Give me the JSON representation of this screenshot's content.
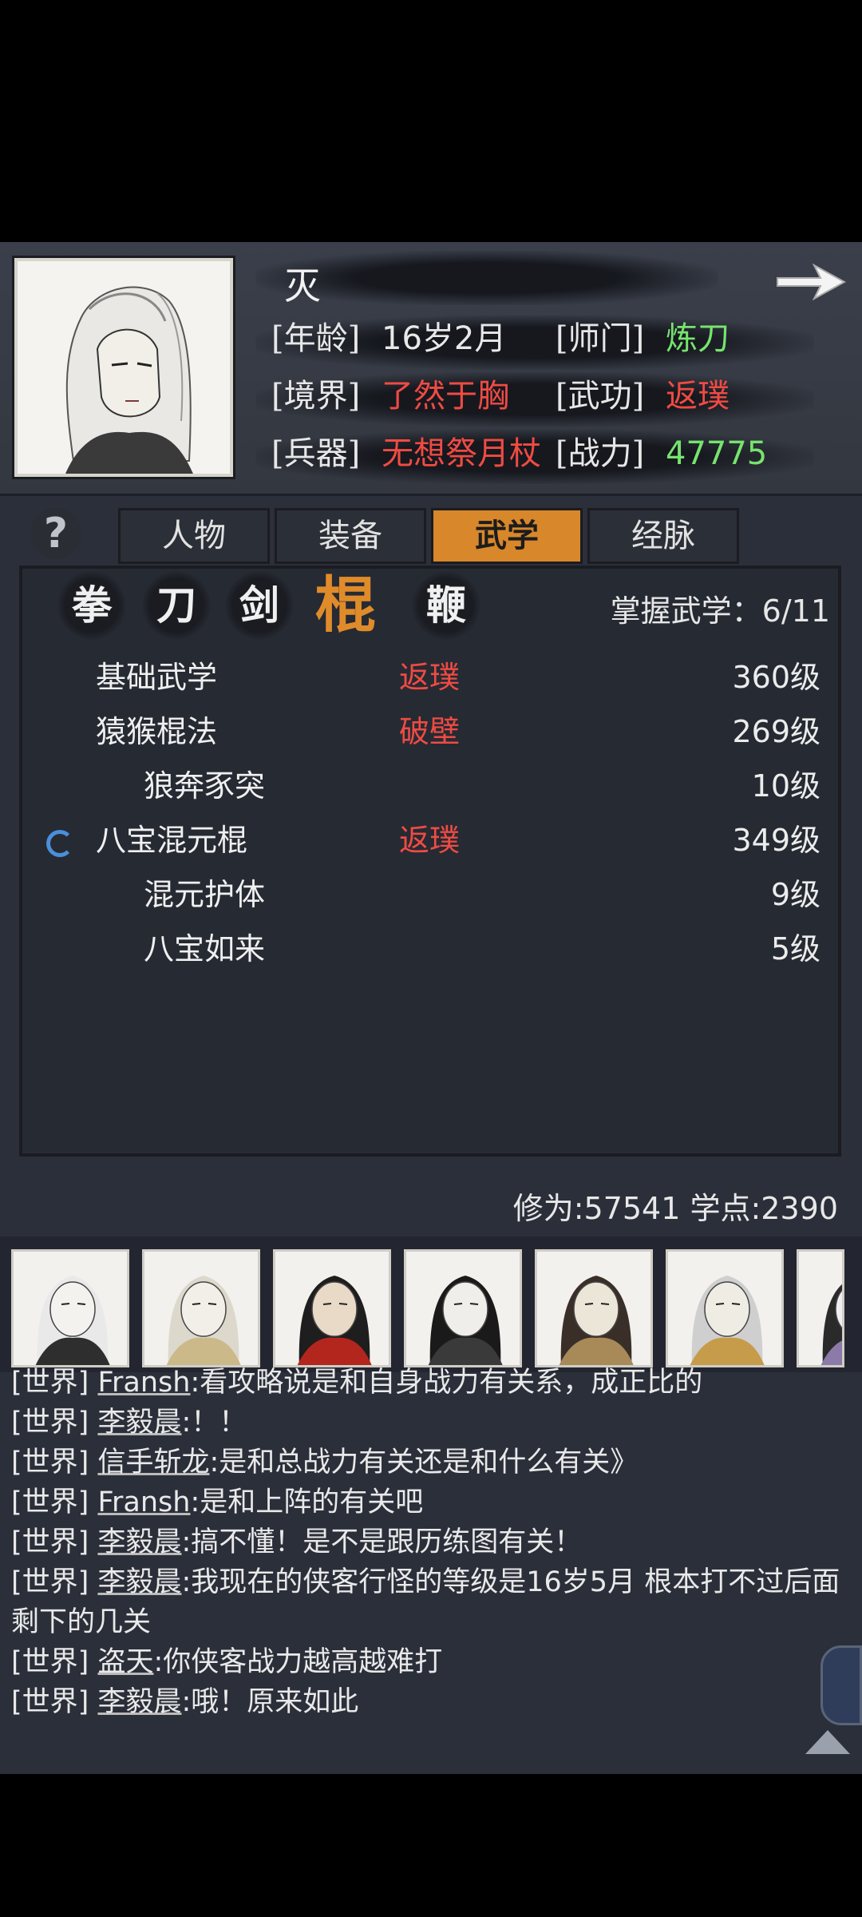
{
  "profile": {
    "name": "灭",
    "stats": [
      {
        "key": "[年龄]",
        "value": "16岁2月",
        "color": "white"
      },
      {
        "key": "[师门]",
        "value": "炼刀",
        "color": "green"
      },
      {
        "key": "[境界]",
        "value": "了然于胸",
        "color": "red"
      },
      {
        "key": "[武功]",
        "value": "返璞",
        "color": "red"
      },
      {
        "key": "[兵器]",
        "value": "无想祭月杖",
        "color": "red"
      },
      {
        "key": "[战力]",
        "value": "47775",
        "color": "green"
      }
    ]
  },
  "tabs": [
    {
      "label": "人物",
      "active": false
    },
    {
      "label": "装备",
      "active": false
    },
    {
      "label": "武学",
      "active": true
    },
    {
      "label": "经脉",
      "active": false
    }
  ],
  "weapon_tabs": [
    {
      "label": "拳",
      "active": false
    },
    {
      "label": "刀",
      "active": false
    },
    {
      "label": "剑",
      "active": false
    },
    {
      "label": "棍",
      "active": true
    },
    {
      "label": "鞭",
      "active": false
    }
  ],
  "mastery": "掌握武学：6/11",
  "martial_arts": [
    {
      "name": "基础武学",
      "rank": "返璞",
      "level": "360级",
      "sub": false,
      "loading": false
    },
    {
      "name": "猿猴棍法",
      "rank": "破壁",
      "level": "269级",
      "sub": false,
      "loading": false
    },
    {
      "name": "狼奔豕突",
      "rank": "",
      "level": "10级",
      "sub": true,
      "loading": false
    },
    {
      "name": "八宝混元棍",
      "rank": "返璞",
      "level": "349级",
      "sub": false,
      "loading": true
    },
    {
      "name": "混元护体",
      "rank": "",
      "level": "9级",
      "sub": true,
      "loading": false
    },
    {
      "name": "八宝如来",
      "rank": "",
      "level": "5级",
      "sub": true,
      "loading": false
    }
  ],
  "cultivation": "修为:57541  学点:2390",
  "colors": {
    "accent": "#d8872b",
    "green": "#77e36f",
    "red": "#ef4b43"
  },
  "chat": [
    {
      "channel": "[世界]",
      "sender": "Fransh",
      "text": ":看攻略说是和自身战力有关系，成正比的"
    },
    {
      "channel": "[世界]",
      "sender": "李毅晨",
      "text": ":！！"
    },
    {
      "channel": "[世界]",
      "sender": "信手斩龙",
      "text": ":是和总战力有关还是和什么有关》"
    },
    {
      "channel": "[世界]",
      "sender": "Fransh",
      "text": ":是和上阵的有关吧"
    },
    {
      "channel": "[世界]",
      "sender": "李毅晨",
      "text": ":搞不懂！是不是跟历练图有关！"
    },
    {
      "channel": "[世界]",
      "sender": "李毅晨",
      "text": ":我现在的侠客行怪的等级是16岁5月 根本打不过后面剩下的几关"
    },
    {
      "channel": "[世界]",
      "sender": "盗天",
      "text": ":你侠客战力越高越难打"
    },
    {
      "channel": "[世界]",
      "sender": "李毅晨",
      "text": ":哦！原来如此"
    }
  ]
}
